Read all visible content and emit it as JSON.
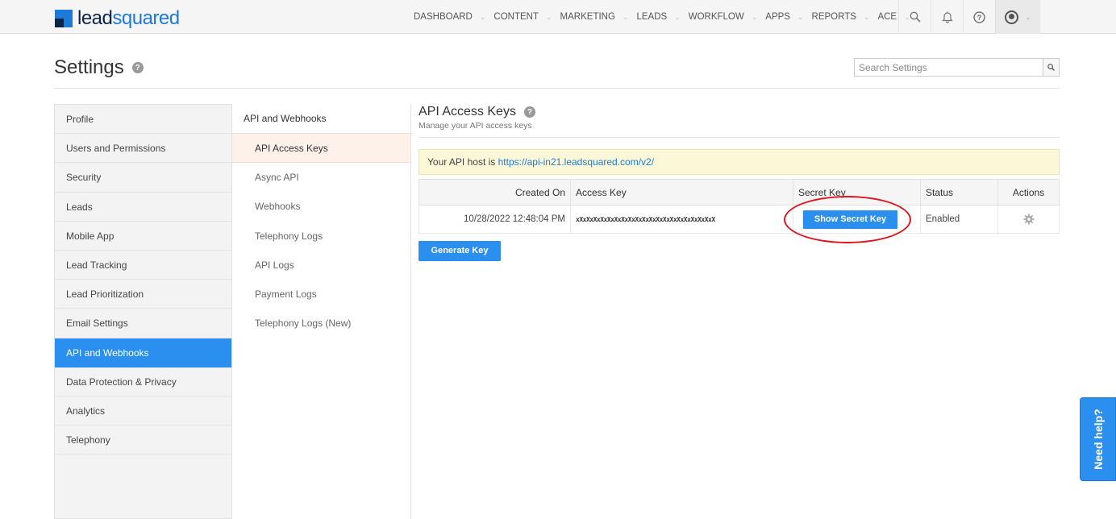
{
  "brand": {
    "name_part1": "lead",
    "name_part2": "squared"
  },
  "nav": {
    "items": [
      {
        "label": "DASHBOARD"
      },
      {
        "label": "CONTENT"
      },
      {
        "label": "MARKETING"
      },
      {
        "label": "LEADS"
      },
      {
        "label": "WORKFLOW"
      },
      {
        "label": "APPS"
      },
      {
        "label": "REPORTS"
      },
      {
        "label": "ACE"
      }
    ],
    "icons": [
      "search-icon",
      "bell-icon",
      "help-icon",
      "user-icon"
    ]
  },
  "header": {
    "title": "Settings",
    "search_placeholder": "Search Settings"
  },
  "leftmenu": {
    "items": [
      {
        "label": "Profile"
      },
      {
        "label": "Users and Permissions"
      },
      {
        "label": "Security"
      },
      {
        "label": "Leads"
      },
      {
        "label": "Mobile App"
      },
      {
        "label": "Lead Tracking"
      },
      {
        "label": "Lead Prioritization"
      },
      {
        "label": "Email Settings"
      },
      {
        "label": "API and Webhooks",
        "active": true
      },
      {
        "label": "Data Protection & Privacy"
      },
      {
        "label": "Analytics"
      },
      {
        "label": "Telephony"
      }
    ]
  },
  "submenu": {
    "heading": "API and Webhooks",
    "items": [
      {
        "label": "API Access Keys",
        "active": true
      },
      {
        "label": "Async API"
      },
      {
        "label": "Webhooks"
      },
      {
        "label": "Telephony Logs"
      },
      {
        "label": "API Logs"
      },
      {
        "label": "Payment Logs"
      },
      {
        "label": "Telephony Logs (New)"
      }
    ]
  },
  "content": {
    "title": "API Access Keys",
    "subtitle": "Manage your API access keys",
    "api_host_prefix": "Your API host is ",
    "api_host_url": "https://api-in21.leadsquared.com/v2/",
    "table": {
      "headers": [
        "Created On",
        "Access Key",
        "Secret Key",
        "Status",
        "Actions"
      ],
      "rows": [
        {
          "created_on": "10/28/2022 12:48:04 PM",
          "access_key": "xXxXxXxXxXxXxXxXxXxXxXxXxXxXxXxXxXxXxXxX",
          "secret_button": "Show Secret Key",
          "status": "Enabled"
        }
      ]
    },
    "generate_button": "Generate Key"
  },
  "help": {
    "label": "Need help?"
  },
  "colors": {
    "accent": "#2b8ff0",
    "highlight_ellipse": "#e0141e",
    "banner_bg": "#fcf8d7"
  }
}
